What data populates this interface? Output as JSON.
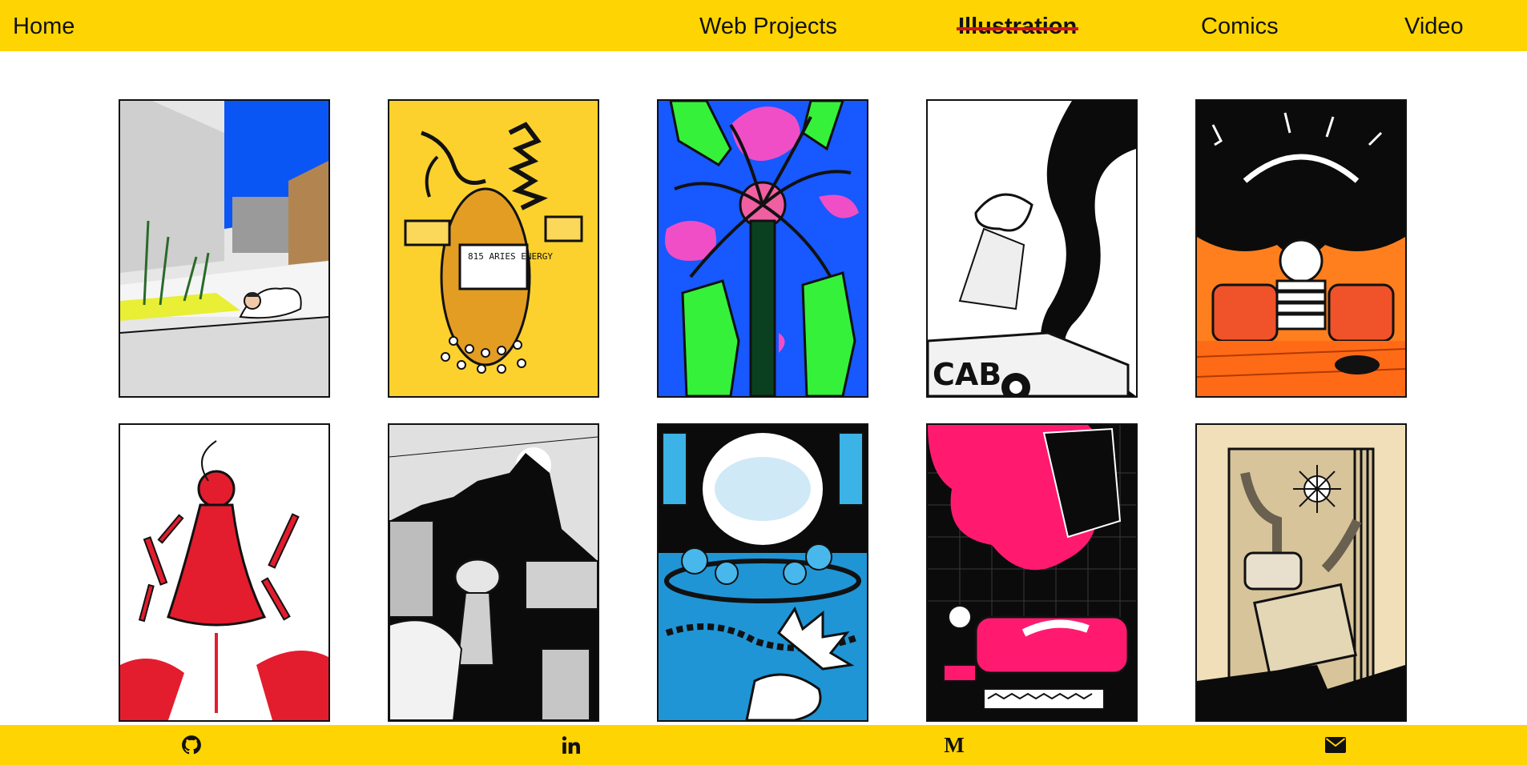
{
  "nav": {
    "home": "Home",
    "web_projects": "Web Projects",
    "illustration": "Illustration",
    "comics": "Comics",
    "video": "Video",
    "active": "illustration"
  },
  "colors": {
    "brand_yellow": "#ffd403",
    "active_strike": "#d3131b",
    "text": "#111111"
  },
  "gallery": {
    "rows": 2,
    "columns": 5,
    "items": [
      {
        "subject": "rooftop-sleeper",
        "palette": "blue-grey-yellow"
      },
      {
        "subject": "energy-creature",
        "palette": "yellow-black",
        "inscription": "815 ARIES ENERGY"
      },
      {
        "subject": "palm-tree-hands",
        "palette": "blue-green-pink"
      },
      {
        "subject": "smoke-car",
        "palette": "black-white",
        "inscription": "CAB"
      },
      {
        "subject": "storm-on-sofa",
        "palette": "orange-black"
      },
      {
        "subject": "red-cloak-figure",
        "palette": "red-white"
      },
      {
        "subject": "mountain-village",
        "palette": "grey-black"
      },
      {
        "subject": "dance-party",
        "palette": "cyan-black"
      },
      {
        "subject": "bathtub-scene",
        "palette": "pink-black"
      },
      {
        "subject": "doorway-robot",
        "palette": "beige-black"
      }
    ]
  },
  "footer": {
    "icons": [
      "github-icon",
      "linkedin-icon",
      "medium-icon",
      "mail-icon"
    ],
    "medium_glyph": "M"
  }
}
